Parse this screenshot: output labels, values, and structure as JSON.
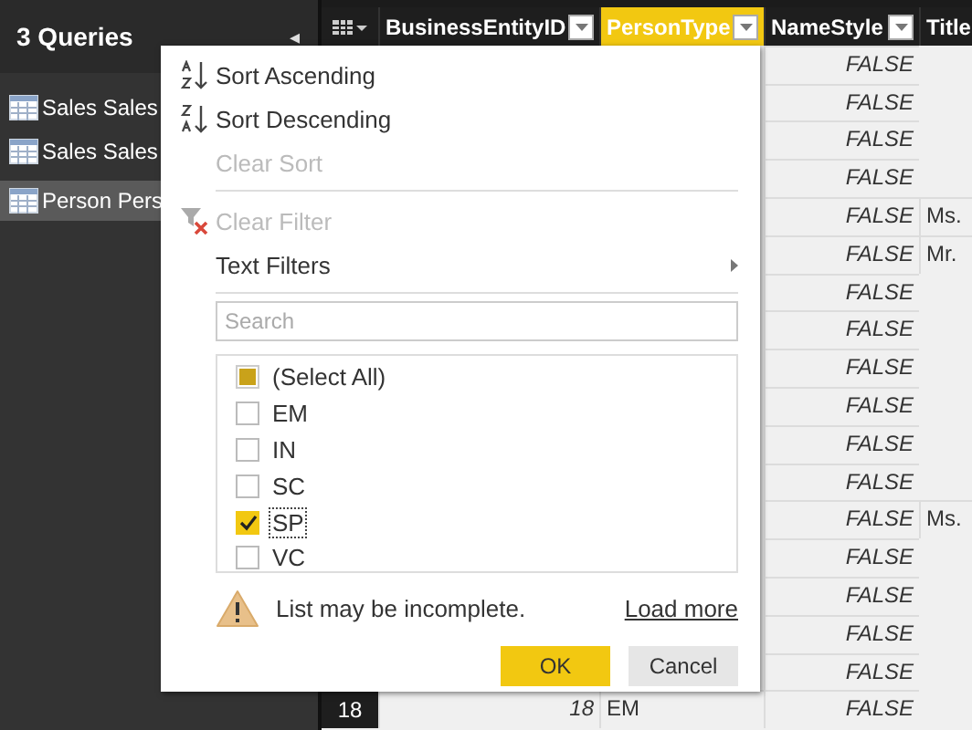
{
  "queries_pane": {
    "title": "3 Queries",
    "collapse_glyph": "◂",
    "items": [
      {
        "label": "Sales Sales",
        "selected": false
      },
      {
        "label": "Sales Sales",
        "selected": false
      },
      {
        "label": "Person Pers",
        "selected": true
      }
    ]
  },
  "table": {
    "columns": [
      {
        "label": "BusinessEntityID",
        "selected": false
      },
      {
        "label": "PersonType",
        "selected": true
      },
      {
        "label": "NameStyle",
        "selected": false
      },
      {
        "label": "Title",
        "selected": false
      }
    ],
    "rows": [
      {
        "name_style": "FALSE"
      },
      {
        "name_style": "FALSE"
      },
      {
        "name_style": "FALSE"
      },
      {
        "name_style": "FALSE"
      },
      {
        "name_style": "FALSE",
        "title": "Ms."
      },
      {
        "name_style": "FALSE",
        "title": "Mr."
      },
      {
        "name_style": "FALSE"
      },
      {
        "name_style": "FALSE"
      },
      {
        "name_style": "FALSE"
      },
      {
        "name_style": "FALSE"
      },
      {
        "name_style": "FALSE"
      },
      {
        "name_style": "FALSE"
      },
      {
        "name_style": "FALSE",
        "title": "Ms."
      },
      {
        "name_style": "FALSE"
      },
      {
        "name_style": "FALSE"
      },
      {
        "name_style": "FALSE"
      },
      {
        "name_style": "FALSE"
      },
      {
        "row_number": "18",
        "business_entity_id": "18",
        "person_type": "EM",
        "name_style": "FALSE"
      }
    ]
  },
  "filter_menu": {
    "items": [
      {
        "kind": "ascending",
        "label": "Sort Ascending",
        "disabled": false
      },
      {
        "kind": "descending",
        "label": "Sort Descending",
        "disabled": false
      },
      {
        "kind": "plain",
        "label": "Clear Sort",
        "disabled": true
      },
      {
        "kind": "divider"
      },
      {
        "kind": "clearfilter",
        "label": "Clear Filter",
        "disabled": true
      },
      {
        "kind": "submenu",
        "label": "Text Filters",
        "disabled": false
      },
      {
        "kind": "divider"
      }
    ],
    "search": {
      "placeholder": "Search"
    },
    "values": [
      {
        "label": "(Select All)",
        "checked": false,
        "partial": true,
        "focused": false
      },
      {
        "label": "EM",
        "checked": false,
        "partial": false,
        "focused": false
      },
      {
        "label": "IN",
        "checked": false,
        "partial": false,
        "focused": false
      },
      {
        "label": "SC",
        "checked": false,
        "partial": false,
        "focused": false
      },
      {
        "label": "SP",
        "checked": true,
        "partial": false,
        "focused": true
      },
      {
        "label": "VC",
        "checked": false,
        "partial": false,
        "focused": false
      }
    ],
    "warning": "List may be incomplete.",
    "load_more": "Load more",
    "buttons": [
      {
        "label": "OK",
        "primary": true
      },
      {
        "label": "Cancel",
        "primary": false
      }
    ]
  }
}
